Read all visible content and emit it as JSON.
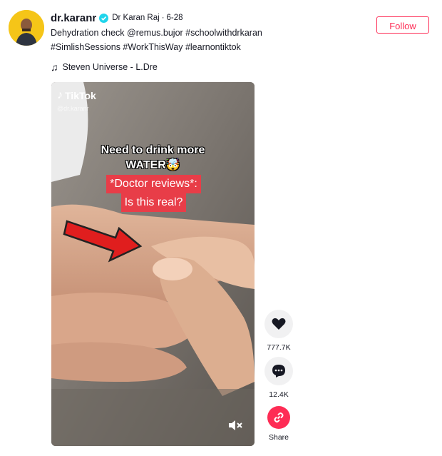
{
  "author": {
    "username": "dr.karanr",
    "nickname": "Dr Karan Raj",
    "separator": "·",
    "date": "6-28"
  },
  "description": {
    "line1": "Dehydration check @remus.bujor #schoolwithdrkaran",
    "line2": "#SimlishSessions #WorkThisWay #learnontiktok"
  },
  "music": {
    "icon": "music-note-icon",
    "title": "Steven Universe - L.Dre"
  },
  "follow_label": "Follow",
  "video": {
    "watermark": "TikTok",
    "watermark_user": "@dr.karanr",
    "caption_line1": "Need to drink more",
    "caption_line2": "WATER🤯",
    "highlight_line1": "*Doctor reviews*:",
    "highlight_line2": "Is this real?"
  },
  "actions": {
    "likes": "777.7K",
    "comments": "12.4K",
    "share_label": "Share"
  },
  "colors": {
    "accent": "#fe2c55",
    "caption_highlight": "#e83d48",
    "verified": "#20d5ec"
  }
}
